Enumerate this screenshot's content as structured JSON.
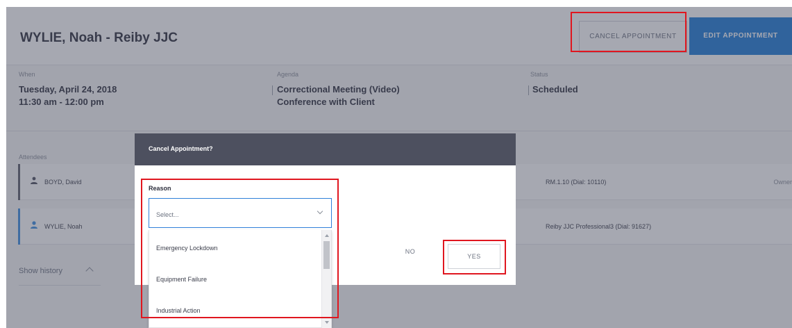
{
  "header": {
    "title": "WYLIE, Noah - Reiby JJC",
    "cancel_appointment_label": "CANCEL APPOINTMENT",
    "edit_appointment_label": "EDIT APPOINTMENT"
  },
  "details": {
    "when_label": "When",
    "when_date": "Tuesday, April 24, 2018",
    "when_time": "11:30 am - 12:00 pm",
    "agenda_label": "Agenda",
    "agenda_line1": "Correctional Meeting (Video)",
    "agenda_line2": "Conference with Client",
    "status_label": "Status",
    "status_value": "Scheduled"
  },
  "attendees": {
    "label": "Attendees",
    "rows": [
      {
        "icon": "group-person-icon",
        "name": "BOYD, David",
        "room": "RM.1.10 (Dial: 10110)",
        "role": "Owner",
        "accent": "#5a5d6a"
      },
      {
        "icon": "person-icon",
        "name": "WYLIE, Noah",
        "room": "Reiby JJC Professional3 (Dial: 91627)",
        "role": "",
        "accent": "#3c8ee0"
      }
    ]
  },
  "show_history_label": "Show history",
  "modal": {
    "title": "Cancel Appointment?",
    "reason_label": "Reason",
    "select_value": "Select...",
    "no_label": "NO",
    "yes_label": "YES"
  },
  "dropdown": {
    "options": [
      "Emergency Lockdown",
      "Equipment Failure",
      "Industrial Action"
    ]
  },
  "colors": {
    "primary": "#1e7bd6",
    "highlight": "#e0161f",
    "modal_header": "#4d505f"
  }
}
